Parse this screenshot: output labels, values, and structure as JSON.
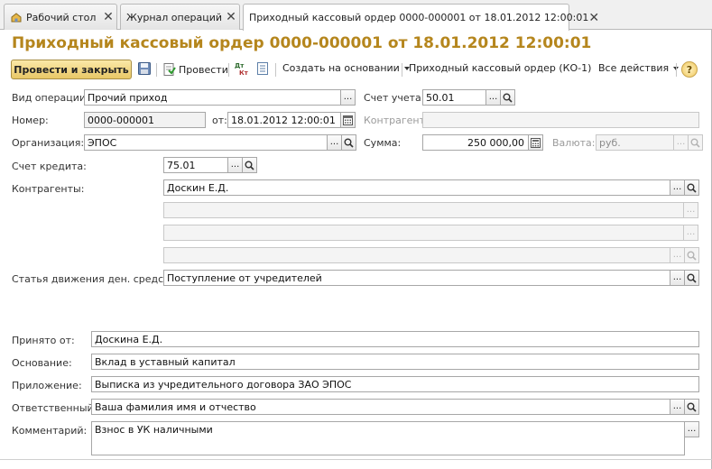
{
  "tabs": [
    {
      "label": "Рабочий стол",
      "icon": "home-icon"
    },
    {
      "label": "Журнал операций"
    },
    {
      "label": "Приходный кассовый ордер 0000-000001 от 18.01.2012 12:00:01",
      "active": true
    }
  ],
  "title": "Приходный кассовый ордер 0000-000001 от 18.01.2012 12:00:01",
  "title_color": "#b5861d",
  "toolbar": {
    "post_close": "Провести и закрыть",
    "post": "Провести",
    "create_based": "Создать на основании",
    "print_form": "Приходный кассовый ордер (КО-1)",
    "all_actions": "Все действия",
    "help": "?",
    "dtkt_top": "Дт",
    "dtkt_bottom": "Кт"
  },
  "form": {
    "operation_type": {
      "label": "Вид операции:",
      "value": "Прочий приход"
    },
    "number": {
      "label": "Номер:",
      "value": "0000-000001"
    },
    "date": {
      "label": "от:",
      "value": "18.01.2012 12:00:01"
    },
    "organization": {
      "label": "Организация:",
      "value": "ЭПОС"
    },
    "account": {
      "label": "Счет учета:",
      "value": "50.01"
    },
    "counterparty": {
      "label": "Контрагент:",
      "value": ""
    },
    "amount": {
      "label": "Сумма:",
      "value": "250 000,00"
    },
    "currency": {
      "label": "Валюта:",
      "value": "руб."
    },
    "credit_account": {
      "label": "Счет кредита:",
      "value": "75.01"
    },
    "counterparties": {
      "label": "Контрагенты:",
      "values": [
        "Доскин Е.Д.",
        "",
        "",
        ""
      ]
    },
    "cash_flow_item": {
      "label": "Статья движения ден. средств:",
      "value": "Поступление от учредителей"
    },
    "received_from": {
      "label": "Принято от:",
      "value": "Доскина Е.Д."
    },
    "basis": {
      "label": "Основание:",
      "value": "Вклад в уставный капитал"
    },
    "attachment": {
      "label": "Приложение:",
      "value": "Выписка из учредительного договора ЗАО ЭПОС"
    },
    "responsible": {
      "label": "Ответственный:",
      "value": "Ваша фамилия имя и отчество"
    },
    "comment": {
      "label": "Комментарий:",
      "value": "Взнос в УК наличными"
    }
  }
}
